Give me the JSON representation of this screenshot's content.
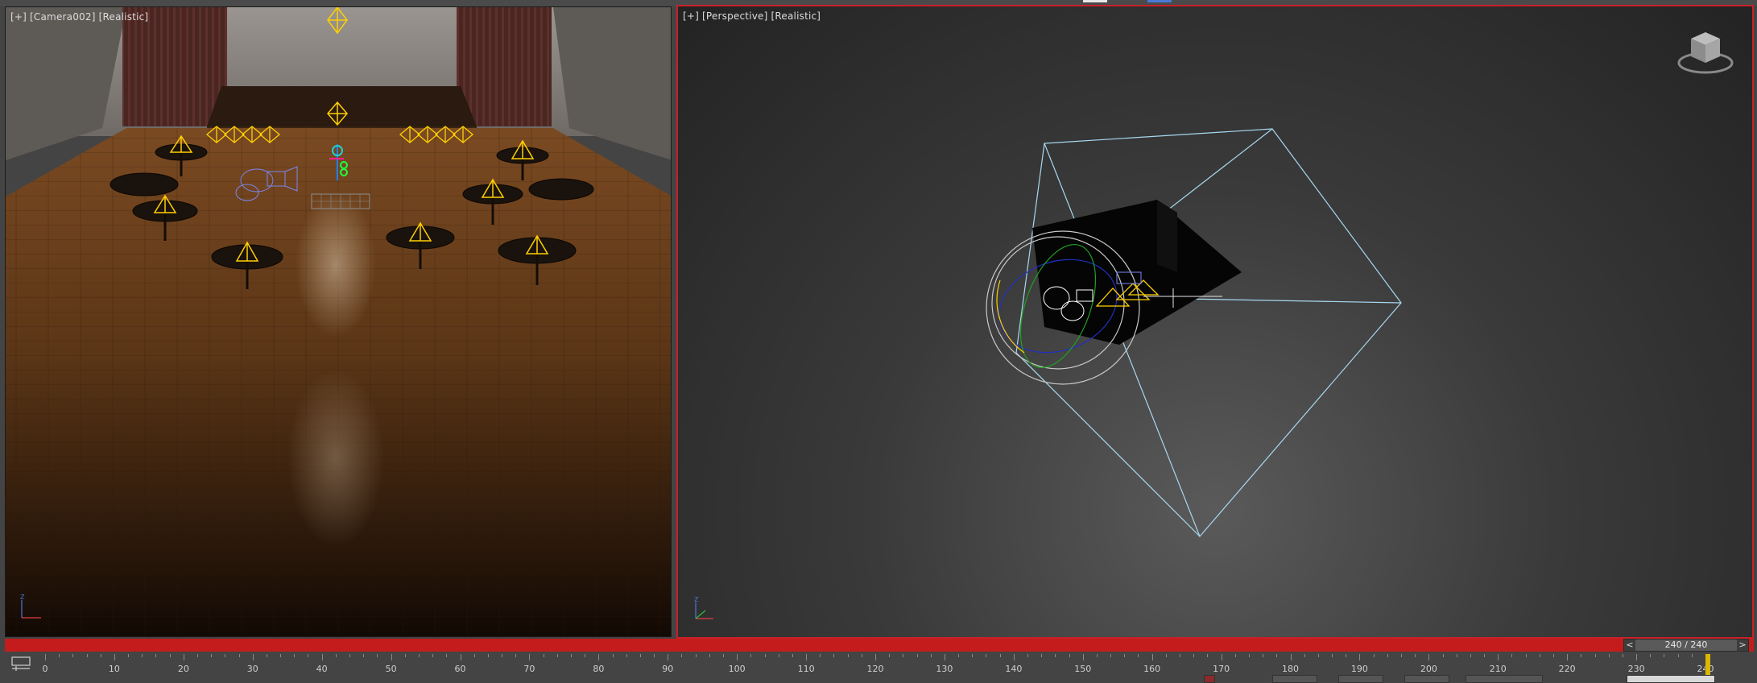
{
  "viewports": {
    "left": {
      "plus": "[+]",
      "camera": "[Camera002]",
      "shading": "[Realistic]"
    },
    "right": {
      "plus": "[+]",
      "view": "[Perspective]",
      "shading": "[Realistic]"
    }
  },
  "axis_gizmo": {
    "x": "X",
    "y": "Y",
    "z": "Z"
  },
  "timeline": {
    "counter": "240 / 240",
    "prev_arrow": "<",
    "next_arrow": ">",
    "ticks": [
      "0",
      "10",
      "20",
      "30",
      "40",
      "50",
      "60",
      "70",
      "80",
      "90",
      "100",
      "110",
      "120",
      "130",
      "140",
      "150",
      "160",
      "170",
      "180",
      "190",
      "200",
      "210",
      "220",
      "230",
      "240"
    ],
    "current_frame": 240
  },
  "icons": {
    "viewcube": "viewcube-icon",
    "track_view": "track-view-icon"
  },
  "colors": {
    "active_viewport_border": "#c8202a",
    "timeline_bar": "#c41c1c",
    "light_gizmo": "#ffd000",
    "camera_frustum": "#a8d8f0"
  }
}
